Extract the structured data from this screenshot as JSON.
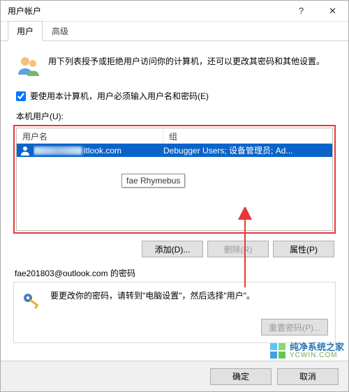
{
  "window": {
    "title": "用户帐户",
    "help_icon": "?",
    "close_icon": "✕"
  },
  "tabs": [
    {
      "label": "用户",
      "active": true
    },
    {
      "label": "高级",
      "active": false
    }
  ],
  "intro": {
    "text": "用下列表授予或拒绝用户访问你的计算机，还可以更改其密码和其他设置。"
  },
  "check": {
    "label": "要使用本计算机，用户必须输入用户名和密码(E)",
    "checked": true
  },
  "list": {
    "label": "本机用户(U):",
    "columns": {
      "user": "用户名",
      "group": "组"
    },
    "rows": [
      {
        "user_suffix": "itlook.com",
        "group": "Debugger Users; 设备管理员; Ad...",
        "selected": true
      }
    ],
    "tooltip": "fae Rhymebus"
  },
  "user_buttons": {
    "add": "添加(D)...",
    "remove": "删除(R)",
    "properties": "属性(P)"
  },
  "password_section": {
    "group_title": "fae201803@outlook.com 的密码",
    "hint": "要更改你的密码，请转到\"电脑设置\"，然后选择\"用户\"。",
    "reset_btn": "重置密码(P)..."
  },
  "footer": {
    "ok": "确定",
    "cancel": "取消"
  },
  "watermark": {
    "line1": "纯净系统之家",
    "line2": "YCWIN.COM"
  }
}
